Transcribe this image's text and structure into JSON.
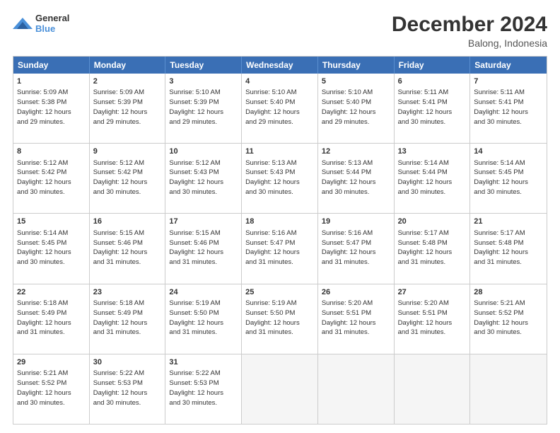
{
  "logo": {
    "line1": "General",
    "line2": "Blue"
  },
  "title": "December 2024",
  "subtitle": "Balong, Indonesia",
  "header_days": [
    "Sunday",
    "Monday",
    "Tuesday",
    "Wednesday",
    "Thursday",
    "Friday",
    "Saturday"
  ],
  "weeks": [
    [
      {
        "day": "1",
        "lines": [
          "Sunrise: 5:09 AM",
          "Sunset: 5:38 PM",
          "Daylight: 12 hours",
          "and 29 minutes."
        ]
      },
      {
        "day": "2",
        "lines": [
          "Sunrise: 5:09 AM",
          "Sunset: 5:39 PM",
          "Daylight: 12 hours",
          "and 29 minutes."
        ]
      },
      {
        "day": "3",
        "lines": [
          "Sunrise: 5:10 AM",
          "Sunset: 5:39 PM",
          "Daylight: 12 hours",
          "and 29 minutes."
        ]
      },
      {
        "day": "4",
        "lines": [
          "Sunrise: 5:10 AM",
          "Sunset: 5:40 PM",
          "Daylight: 12 hours",
          "and 29 minutes."
        ]
      },
      {
        "day": "5",
        "lines": [
          "Sunrise: 5:10 AM",
          "Sunset: 5:40 PM",
          "Daylight: 12 hours",
          "and 29 minutes."
        ]
      },
      {
        "day": "6",
        "lines": [
          "Sunrise: 5:11 AM",
          "Sunset: 5:41 PM",
          "Daylight: 12 hours",
          "and 30 minutes."
        ]
      },
      {
        "day": "7",
        "lines": [
          "Sunrise: 5:11 AM",
          "Sunset: 5:41 PM",
          "Daylight: 12 hours",
          "and 30 minutes."
        ]
      }
    ],
    [
      {
        "day": "8",
        "lines": [
          "Sunrise: 5:12 AM",
          "Sunset: 5:42 PM",
          "Daylight: 12 hours",
          "and 30 minutes."
        ]
      },
      {
        "day": "9",
        "lines": [
          "Sunrise: 5:12 AM",
          "Sunset: 5:42 PM",
          "Daylight: 12 hours",
          "and 30 minutes."
        ]
      },
      {
        "day": "10",
        "lines": [
          "Sunrise: 5:12 AM",
          "Sunset: 5:43 PM",
          "Daylight: 12 hours",
          "and 30 minutes."
        ]
      },
      {
        "day": "11",
        "lines": [
          "Sunrise: 5:13 AM",
          "Sunset: 5:43 PM",
          "Daylight: 12 hours",
          "and 30 minutes."
        ]
      },
      {
        "day": "12",
        "lines": [
          "Sunrise: 5:13 AM",
          "Sunset: 5:44 PM",
          "Daylight: 12 hours",
          "and 30 minutes."
        ]
      },
      {
        "day": "13",
        "lines": [
          "Sunrise: 5:14 AM",
          "Sunset: 5:44 PM",
          "Daylight: 12 hours",
          "and 30 minutes."
        ]
      },
      {
        "day": "14",
        "lines": [
          "Sunrise: 5:14 AM",
          "Sunset: 5:45 PM",
          "Daylight: 12 hours",
          "and 30 minutes."
        ]
      }
    ],
    [
      {
        "day": "15",
        "lines": [
          "Sunrise: 5:14 AM",
          "Sunset: 5:45 PM",
          "Daylight: 12 hours",
          "and 30 minutes."
        ]
      },
      {
        "day": "16",
        "lines": [
          "Sunrise: 5:15 AM",
          "Sunset: 5:46 PM",
          "Daylight: 12 hours",
          "and 31 minutes."
        ]
      },
      {
        "day": "17",
        "lines": [
          "Sunrise: 5:15 AM",
          "Sunset: 5:46 PM",
          "Daylight: 12 hours",
          "and 31 minutes."
        ]
      },
      {
        "day": "18",
        "lines": [
          "Sunrise: 5:16 AM",
          "Sunset: 5:47 PM",
          "Daylight: 12 hours",
          "and 31 minutes."
        ]
      },
      {
        "day": "19",
        "lines": [
          "Sunrise: 5:16 AM",
          "Sunset: 5:47 PM",
          "Daylight: 12 hours",
          "and 31 minutes."
        ]
      },
      {
        "day": "20",
        "lines": [
          "Sunrise: 5:17 AM",
          "Sunset: 5:48 PM",
          "Daylight: 12 hours",
          "and 31 minutes."
        ]
      },
      {
        "day": "21",
        "lines": [
          "Sunrise: 5:17 AM",
          "Sunset: 5:48 PM",
          "Daylight: 12 hours",
          "and 31 minutes."
        ]
      }
    ],
    [
      {
        "day": "22",
        "lines": [
          "Sunrise: 5:18 AM",
          "Sunset: 5:49 PM",
          "Daylight: 12 hours",
          "and 31 minutes."
        ]
      },
      {
        "day": "23",
        "lines": [
          "Sunrise: 5:18 AM",
          "Sunset: 5:49 PM",
          "Daylight: 12 hours",
          "and 31 minutes."
        ]
      },
      {
        "day": "24",
        "lines": [
          "Sunrise: 5:19 AM",
          "Sunset: 5:50 PM",
          "Daylight: 12 hours",
          "and 31 minutes."
        ]
      },
      {
        "day": "25",
        "lines": [
          "Sunrise: 5:19 AM",
          "Sunset: 5:50 PM",
          "Daylight: 12 hours",
          "and 31 minutes."
        ]
      },
      {
        "day": "26",
        "lines": [
          "Sunrise: 5:20 AM",
          "Sunset: 5:51 PM",
          "Daylight: 12 hours",
          "and 31 minutes."
        ]
      },
      {
        "day": "27",
        "lines": [
          "Sunrise: 5:20 AM",
          "Sunset: 5:51 PM",
          "Daylight: 12 hours",
          "and 31 minutes."
        ]
      },
      {
        "day": "28",
        "lines": [
          "Sunrise: 5:21 AM",
          "Sunset: 5:52 PM",
          "Daylight: 12 hours",
          "and 30 minutes."
        ]
      }
    ],
    [
      {
        "day": "29",
        "lines": [
          "Sunrise: 5:21 AM",
          "Sunset: 5:52 PM",
          "Daylight: 12 hours",
          "and 30 minutes."
        ]
      },
      {
        "day": "30",
        "lines": [
          "Sunrise: 5:22 AM",
          "Sunset: 5:53 PM",
          "Daylight: 12 hours",
          "and 30 minutes."
        ]
      },
      {
        "day": "31",
        "lines": [
          "Sunrise: 5:22 AM",
          "Sunset: 5:53 PM",
          "Daylight: 12 hours",
          "and 30 minutes."
        ]
      },
      {
        "day": "",
        "lines": []
      },
      {
        "day": "",
        "lines": []
      },
      {
        "day": "",
        "lines": []
      },
      {
        "day": "",
        "lines": []
      }
    ]
  ]
}
